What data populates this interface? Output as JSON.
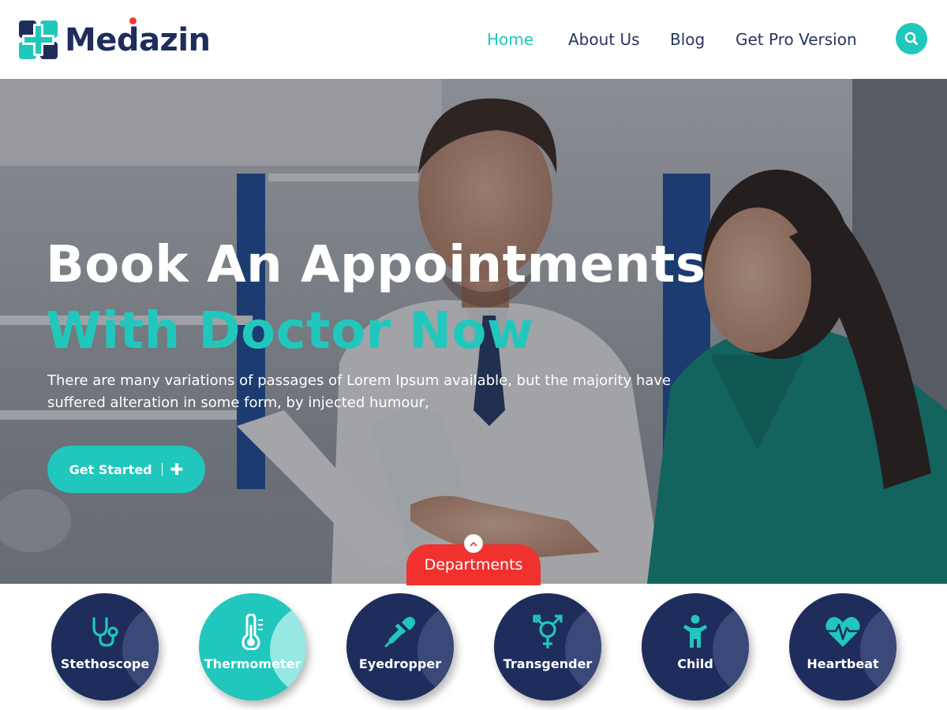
{
  "brand": {
    "name": "Medazin"
  },
  "nav": {
    "items": [
      {
        "label": "Home",
        "active": true
      },
      {
        "label": "About Us",
        "active": false
      },
      {
        "label": "Blog",
        "active": false
      },
      {
        "label": "Get Pro Version",
        "active": false
      }
    ],
    "search_icon": "search-icon"
  },
  "hero": {
    "title_line1": "Book An Appointments",
    "title_line2": "With Doctor Now",
    "description": "There are many variations of passages of Lorem Ipsum available, but the majority have suffered alteration in some form, by injected humour,",
    "cta_label": "Get Started",
    "cta_icon": "plus-icon"
  },
  "departments": {
    "tab_label": "Departments",
    "toggle_icon": "chevron-up-icon",
    "items": [
      {
        "label": "Stethoscope",
        "icon": "stethoscope-icon",
        "active": false
      },
      {
        "label": "Thermometer",
        "icon": "thermometer-icon",
        "active": true
      },
      {
        "label": "Eyedropper",
        "icon": "eyedropper-icon",
        "active": false
      },
      {
        "label": "Transgender",
        "icon": "transgender-icon",
        "active": false
      },
      {
        "label": "Child",
        "icon": "child-icon",
        "active": false
      },
      {
        "label": "Heartbeat",
        "icon": "heartbeat-icon",
        "active": false
      }
    ]
  },
  "colors": {
    "accent": "#21c7bc",
    "navy": "#1f2d5c",
    "red": "#f0312e"
  }
}
